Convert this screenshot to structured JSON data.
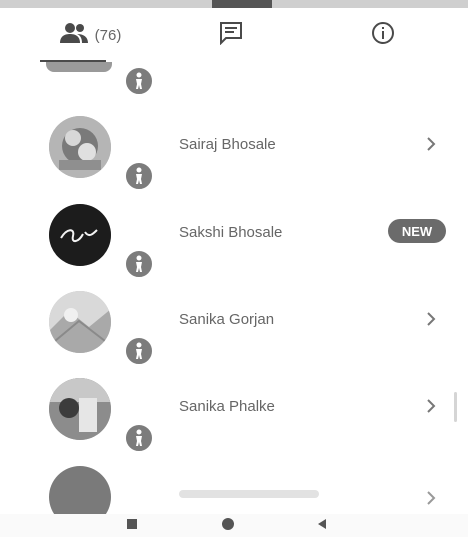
{
  "tabs": {
    "participants_count": "(76)",
    "items": [
      {
        "name": "participants",
        "icon": "people-icon"
      },
      {
        "name": "chat",
        "icon": "chat-icon"
      },
      {
        "name": "info",
        "icon": "info-icon"
      }
    ]
  },
  "participants": [
    {
      "name": "Sairaj Bhosale",
      "action": "chevron"
    },
    {
      "name": "Sakshi Bhosale",
      "action": "new",
      "badge": "NEW"
    },
    {
      "name": "Sanika Gorjan",
      "action": "chevron"
    },
    {
      "name": "Sanika Phalke",
      "action": "chevron"
    }
  ],
  "colors": {
    "accent": "#4a4a4a",
    "badge_bg": "#6b6b6b",
    "status_bg": "#7c7c7c"
  },
  "navbar": {
    "items": [
      "recents-button",
      "home-button",
      "back-button"
    ]
  }
}
